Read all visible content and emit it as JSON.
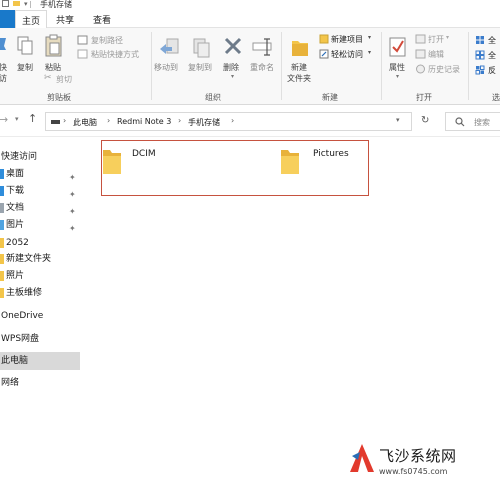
{
  "window": {
    "title": "手机存储"
  },
  "tabs": {
    "file": "",
    "home": "主页",
    "share": "共享",
    "view": "查看"
  },
  "ribbon": {
    "pin_label_line1": "快",
    "pin_label_line2": "访",
    "copy": "复制",
    "paste": "粘贴",
    "copy_path": "复制路径",
    "paste_shortcut": "粘贴快捷方式",
    "cut": "剪切",
    "group_clipboard": "剪贴板",
    "move_to": "移动到",
    "copy_to": "复制到",
    "delete": "删除",
    "rename": "重命名",
    "group_organize": "组织",
    "new_item": "新建项目",
    "easy_access": "轻松访问",
    "new_folder_line1": "新建",
    "new_folder_line2": "文件夹",
    "group_new": "新建",
    "properties": "属性",
    "open": "打开",
    "edit": "编辑",
    "history": "历史记录",
    "group_open": "打开",
    "select_all": "全",
    "select_none": "全",
    "invert": "反",
    "group_select": "选"
  },
  "address": {
    "crumbs": [
      "此电脑",
      "Redmi Note 3",
      "手机存储"
    ],
    "search_placeholder": "搜索"
  },
  "nav": {
    "quick_access": "快速访问",
    "desktop": "桌面",
    "downloads": "下载",
    "documents": "文档",
    "pictures": "图片",
    "f2052": "2052",
    "new_folder": "新建文件夹",
    "photos": "照片",
    "mainboard": "主板维修",
    "onedrive": "OneDrive",
    "wps": "WPS网盘",
    "this_pc": "此电脑",
    "network": "网络"
  },
  "folders": [
    {
      "name": "DCIM"
    },
    {
      "name": "Pictures"
    }
  ],
  "watermark": {
    "brand": "飞沙系统网",
    "url": "www.fs0745.com"
  },
  "colors": {
    "accent": "#1979ca",
    "folder": "#f3c54a",
    "highlight_box": "#c6523f",
    "selected": "#d9d9d9"
  }
}
